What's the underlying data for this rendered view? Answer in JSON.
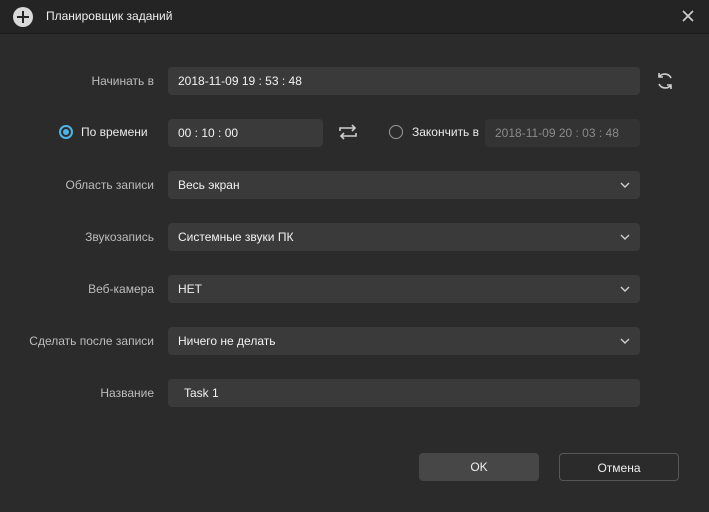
{
  "window": {
    "title": "Планировщик заданий"
  },
  "start": {
    "label": "Начинать в",
    "value": "2018-11-09 19 : 53 : 48"
  },
  "duration": {
    "by_time_label": "По времени",
    "value": "00 : 10 : 00",
    "end_label": "Закончить в",
    "end_value": "2018-11-09 20 : 03 : 48"
  },
  "area": {
    "label": "Область записи",
    "value": "Весь экран"
  },
  "audio": {
    "label": "Звукозапись",
    "value": "Системные звуки ПК"
  },
  "webcam": {
    "label": "Веб-камера",
    "value": "НЕТ"
  },
  "after": {
    "label": "Сделать после записи",
    "value": "Ничего не делать"
  },
  "name": {
    "label": "Название",
    "value": "Task 1"
  },
  "buttons": {
    "ok": "OK",
    "cancel": "Отмена"
  },
  "icons": {
    "app": "add-circle-icon",
    "close": "close-icon",
    "refresh": "refresh-icon",
    "swap": "swap-icon",
    "dropdown": "chevron-down-icon"
  },
  "colors": {
    "accent": "#4fb3e8",
    "background": "#2b2b2b",
    "field": "#3a3a3a"
  }
}
